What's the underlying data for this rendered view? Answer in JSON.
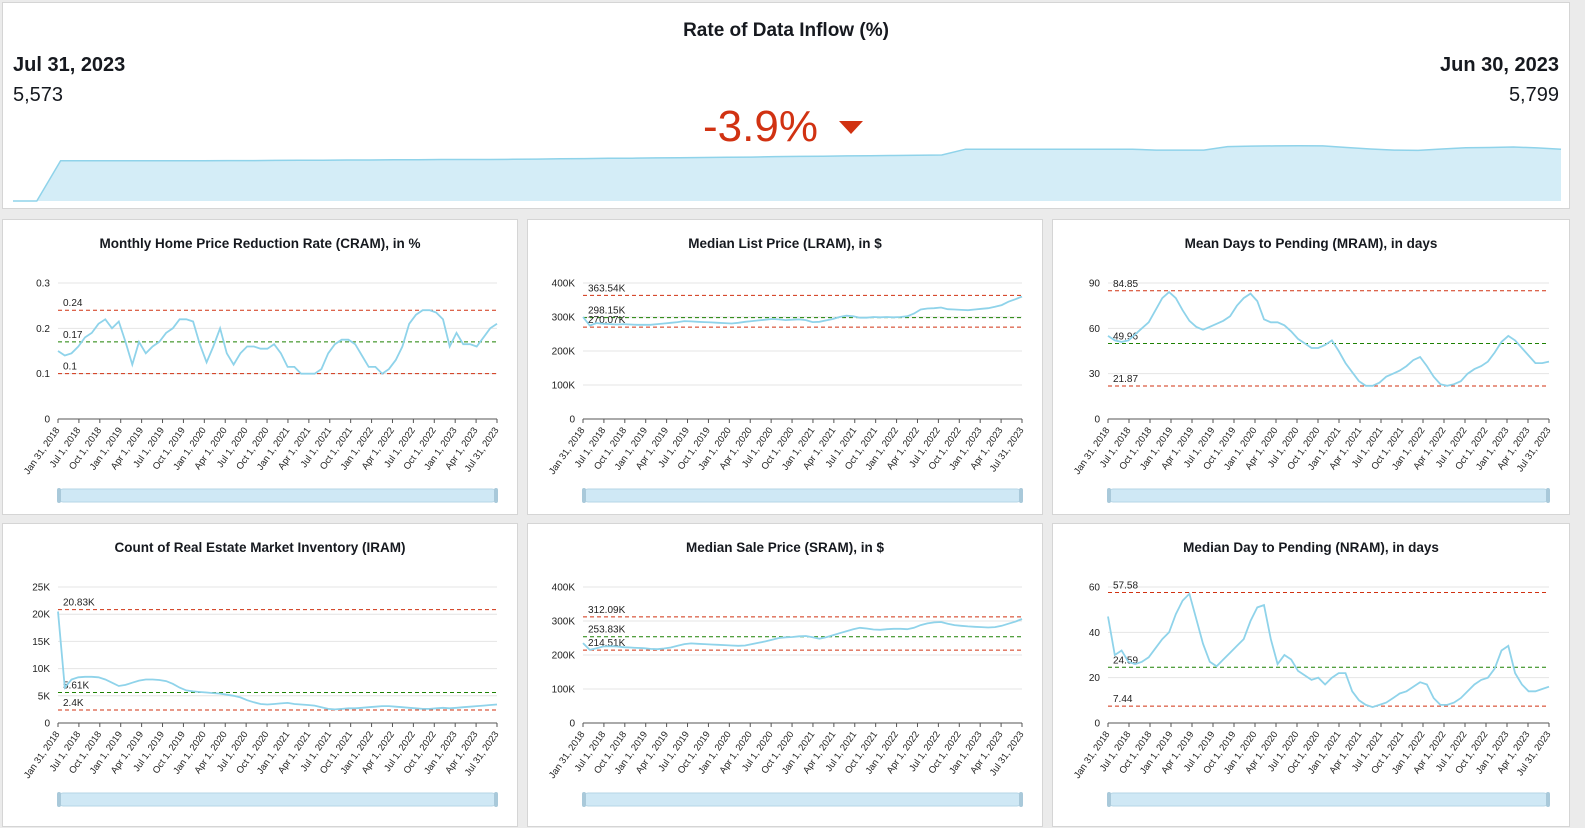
{
  "kpi": {
    "title": "Rate of Data Inflow (%)",
    "current_date": "Jul 31, 2023",
    "current_value": "5,573",
    "previous_date": "Jun 30, 2023",
    "previous_value": "5,799",
    "change": "-3.9%",
    "change_color": "#d13212",
    "trend_icon": "triangle-down-icon",
    "sparkline_fill": "#d4edf7",
    "sparkline_stroke": "#8fd3ea"
  },
  "colors": {
    "line": "#8fd3ea",
    "upper_ref": "#d13212",
    "lower_ref": "#d13212",
    "mean_ref": "#1d8102",
    "scrollbar": "#cfe8f5"
  },
  "x_tick_labels": [
    "Jan 31, 2018",
    "Jul 1, 2018",
    "Oct 1, 2018",
    "Jan 1, 2019",
    "Apr 1, 2019",
    "Jul 1, 2019",
    "Oct 1, 2019",
    "Jan 1, 2020",
    "Apr 1, 2020",
    "Jul 1, 2020",
    "Oct 1, 2020",
    "Jan 1, 2021",
    "Apr 1, 2021",
    "Jul 1, 2021",
    "Oct 1, 2021",
    "Jan 1, 2022",
    "Apr 1, 2022",
    "Jul 1, 2022",
    "Oct 1, 2022",
    "Jan 1, 2023",
    "Apr 1, 2023",
    "Jul 31, 2023"
  ],
  "chart_data": [
    {
      "id": "cram",
      "type": "line",
      "title": "Monthly Home Price Reduction Rate (CRAM), in %",
      "ylim": [
        0,
        0.3
      ],
      "yticks": [
        0,
        0.1,
        0.2,
        0.3
      ],
      "ytick_labels": [
        "0",
        "0.1",
        "0.2",
        "0.3"
      ],
      "refs": [
        {
          "kind": "upper",
          "value": 0.24,
          "label": "0.24"
        },
        {
          "kind": "mean",
          "value": 0.17,
          "label": "0.17"
        },
        {
          "kind": "lower",
          "value": 0.1,
          "label": "0.1"
        }
      ],
      "values": [
        0.15,
        0.14,
        0.145,
        0.16,
        0.18,
        0.19,
        0.21,
        0.22,
        0.2,
        0.215,
        0.17,
        0.12,
        0.17,
        0.145,
        0.16,
        0.17,
        0.19,
        0.2,
        0.22,
        0.22,
        0.215,
        0.165,
        0.125,
        0.16,
        0.2,
        0.145,
        0.12,
        0.145,
        0.16,
        0.16,
        0.155,
        0.155,
        0.165,
        0.145,
        0.115,
        0.115,
        0.1,
        0.1,
        0.1,
        0.11,
        0.145,
        0.165,
        0.175,
        0.175,
        0.165,
        0.14,
        0.115,
        0.115,
        0.1,
        0.11,
        0.13,
        0.16,
        0.21,
        0.23,
        0.24,
        0.24,
        0.235,
        0.22,
        0.16,
        0.19,
        0.165,
        0.165,
        0.16,
        0.18,
        0.2,
        0.21
      ]
    },
    {
      "id": "lram",
      "type": "line",
      "title": "Median List Price (LRAM), in $",
      "ylim": [
        0,
        400000
      ],
      "yticks": [
        0,
        100000,
        200000,
        300000,
        400000
      ],
      "ytick_labels": [
        "0",
        "100K",
        "200K",
        "300K",
        "400K"
      ],
      "refs": [
        {
          "kind": "upper",
          "value": 363540,
          "label": "363.54K"
        },
        {
          "kind": "mean",
          "value": 298150,
          "label": "298.15K"
        },
        {
          "kind": "lower",
          "value": 270070,
          "label": "270.07K"
        }
      ],
      "values": [
        300000,
        275000,
        282000,
        280000,
        279000,
        278000,
        279000,
        278000,
        277000,
        277000,
        277000,
        279000,
        281000,
        283000,
        285000,
        288000,
        287000,
        286000,
        285000,
        284000,
        283000,
        282000,
        281000,
        283000,
        286000,
        288000,
        290000,
        292000,
        294000,
        293000,
        291000,
        292000,
        293000,
        291000,
        285000,
        286000,
        290000,
        294000,
        300000,
        304000,
        302000,
        298000,
        298000,
        300000,
        299000,
        300000,
        299000,
        300000,
        302000,
        310000,
        322000,
        325000,
        326000,
        328000,
        323000,
        322000,
        321000,
        320000,
        322000,
        324000,
        326000,
        330000,
        335000,
        345000,
        352000,
        360000
      ]
    },
    {
      "id": "mram",
      "type": "line",
      "title": "Mean Days to Pending (MRAM), in days",
      "ylim": [
        0,
        90
      ],
      "yticks": [
        0,
        30,
        60,
        90
      ],
      "ytick_labels": [
        "0",
        "30",
        "60",
        "90"
      ],
      "refs": [
        {
          "kind": "upper",
          "value": 84.85,
          "label": "84.85"
        },
        {
          "kind": "mean",
          "value": 49.96,
          "label": "49.96"
        },
        {
          "kind": "lower",
          "value": 21.87,
          "label": "21.87"
        }
      ],
      "values": [
        55,
        52,
        51,
        52,
        56,
        60,
        64,
        72,
        80,
        84,
        80,
        72,
        65,
        61,
        59,
        61,
        63,
        65,
        68,
        75,
        80,
        83,
        78,
        66,
        64,
        64,
        62,
        58,
        53,
        50,
        47,
        47,
        49,
        52,
        45,
        37,
        31,
        25,
        22,
        22,
        24,
        28,
        30,
        32,
        35,
        39,
        41,
        35,
        28,
        23,
        22,
        23,
        25,
        30,
        33,
        35,
        38,
        44,
        51,
        55,
        52,
        47,
        42,
        37,
        37,
        38
      ]
    },
    {
      "id": "iram",
      "type": "line",
      "title": "Count of Real Estate Market Inventory (IRAM)",
      "ylim": [
        0,
        25000
      ],
      "yticks": [
        0,
        5000,
        10000,
        15000,
        20000,
        25000
      ],
      "ytick_labels": [
        "0",
        "5K",
        "10K",
        "15K",
        "20K",
        "25K"
      ],
      "refs": [
        {
          "kind": "upper",
          "value": 20830,
          "label": "20.83K"
        },
        {
          "kind": "mean",
          "value": 5610,
          "label": "5.61K"
        },
        {
          "kind": "lower",
          "value": 2400,
          "label": "2.4K"
        }
      ],
      "values": [
        20500,
        6500,
        8000,
        8400,
        8500,
        8500,
        8400,
        8000,
        7400,
        6800,
        7000,
        7400,
        7800,
        8000,
        8000,
        7900,
        7700,
        7200,
        6500,
        6000,
        5800,
        5700,
        5600,
        5500,
        5400,
        5200,
        5000,
        4700,
        4200,
        3800,
        3500,
        3400,
        3500,
        3600,
        3700,
        3500,
        3400,
        3300,
        3200,
        2900,
        2600,
        2500,
        2600,
        2700,
        2700,
        2800,
        2900,
        3000,
        3100,
        3100,
        3000,
        2900,
        2800,
        2700,
        2600,
        2600,
        2700,
        2800,
        2700,
        2800,
        2900,
        3000,
        3100,
        3200,
        3300,
        3400
      ]
    },
    {
      "id": "sram",
      "type": "line",
      "title": "Median Sale Price (SRAM), in $",
      "ylim": [
        0,
        400000
      ],
      "yticks": [
        0,
        100000,
        200000,
        300000,
        400000
      ],
      "ytick_labels": [
        "0",
        "100K",
        "200K",
        "300K",
        "400K"
      ],
      "refs": [
        {
          "kind": "upper",
          "value": 312090,
          "label": "312.09K"
        },
        {
          "kind": "mean",
          "value": 253830,
          "label": "253.83K"
        },
        {
          "kind": "lower",
          "value": 214510,
          "label": "214.51K"
        }
      ],
      "values": [
        235000,
        215000,
        220000,
        225000,
        226000,
        225000,
        223000,
        222000,
        221000,
        220000,
        218000,
        217000,
        219000,
        222000,
        227000,
        232000,
        234000,
        233000,
        232000,
        231000,
        230000,
        229000,
        228000,
        227000,
        228000,
        232000,
        236000,
        240000,
        245000,
        250000,
        252000,
        253000,
        255000,
        256000,
        252000,
        248000,
        252000,
        258000,
        264000,
        270000,
        276000,
        280000,
        278000,
        275000,
        274000,
        276000,
        277000,
        277000,
        276000,
        280000,
        288000,
        293000,
        296000,
        297000,
        292000,
        288000,
        286000,
        284000,
        283000,
        282000,
        281000,
        282000,
        286000,
        292000,
        298000,
        306000
      ]
    },
    {
      "id": "nram",
      "type": "line",
      "title": "Median Day to Pending (NRAM), in days",
      "ylim": [
        0,
        60
      ],
      "yticks": [
        0,
        20,
        40,
        60
      ],
      "ytick_labels": [
        "0",
        "20",
        "40",
        "60"
      ],
      "refs": [
        {
          "kind": "upper",
          "value": 57.58,
          "label": "57.58"
        },
        {
          "kind": "mean",
          "value": 24.59,
          "label": "24.59"
        },
        {
          "kind": "lower",
          "value": 7.44,
          "label": "7.44"
        }
      ],
      "values": [
        47,
        30,
        32,
        27,
        26,
        27,
        29,
        33,
        37,
        40,
        48,
        54,
        57,
        46,
        35,
        27,
        25,
        28,
        31,
        34,
        37,
        45,
        51,
        52,
        37,
        26,
        30,
        28,
        23,
        21,
        19,
        20,
        17,
        20,
        22,
        22,
        14,
        10,
        8,
        7,
        8,
        9,
        11,
        13,
        14,
        16,
        18,
        17,
        11,
        8,
        8,
        9,
        11,
        14,
        17,
        19,
        20,
        24,
        32,
        34,
        22,
        17,
        14,
        14,
        15,
        16
      ]
    }
  ],
  "kpi_chart_data": {
    "type": "area",
    "values": [
      0,
      0,
      180,
      180,
      180,
      180,
      180,
      180,
      180,
      181,
      181,
      182,
      183,
      183,
      184,
      184,
      185,
      185,
      186,
      186,
      186,
      187,
      188,
      189,
      190,
      192,
      192,
      193,
      194,
      195,
      196,
      197,
      199,
      200,
      201,
      202,
      203,
      204,
      205,
      206,
      232,
      232,
      232,
      232,
      232,
      232,
      232,
      232,
      228,
      228,
      228,
      244,
      246,
      247,
      248,
      247,
      240,
      233,
      228,
      227,
      233,
      239,
      240,
      242,
      238,
      232
    ]
  }
}
